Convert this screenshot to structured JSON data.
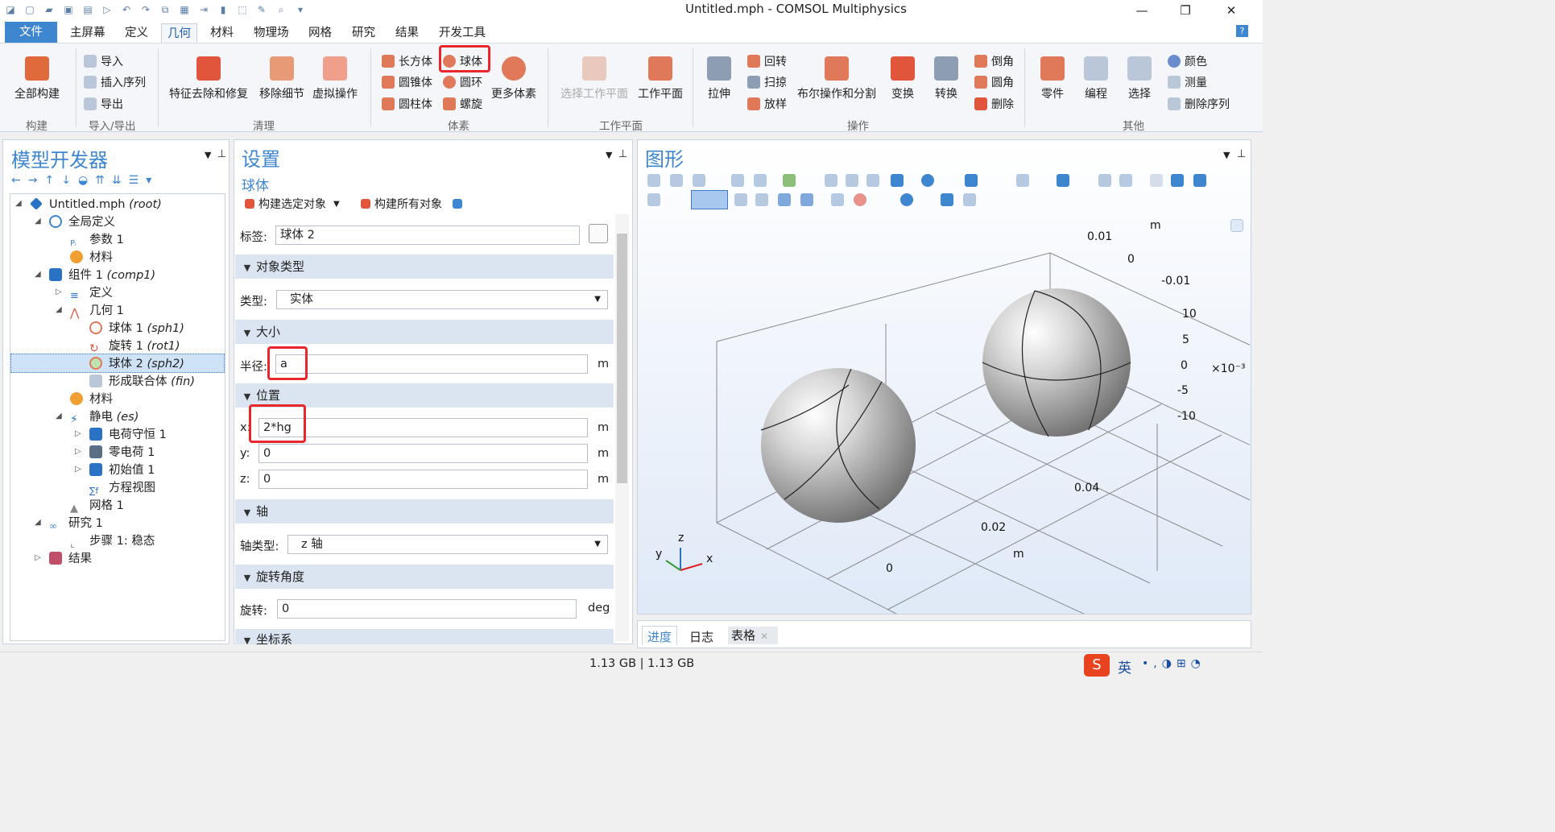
{
  "window": {
    "title": "Untitled.mph - COMSOL Multiphysics",
    "minimize": "—",
    "restore": "❐",
    "close": "✕"
  },
  "menu": {
    "file": "文件",
    "tabs": [
      "主屏幕",
      "定义",
      "几何",
      "材料",
      "物理场",
      "网格",
      "研究",
      "结果",
      "开发工具"
    ],
    "help": "?"
  },
  "ribbon": {
    "build_all": "全部构建",
    "import": "导入",
    "insert_sequence": "插入序列",
    "export": "导出",
    "feature_repair": "特征去除和修复",
    "remove_details": "移除细节",
    "virtual_ops": "虚拟操作",
    "block": "长方体",
    "cone": "圆锥体",
    "cylinder": "圆柱体",
    "sphere": "球体",
    "torus": "圆环",
    "helix": "螺旋",
    "more_primitives": "更多体素",
    "select_work_plane": "选择工作平面",
    "work_plane": "工作平面",
    "extrude": "拉伸",
    "revolve": "回转",
    "sweep": "扫掠",
    "loft": "放样",
    "booleans": "布尔操作和分割",
    "transforms": "变换",
    "conversions": "转换",
    "chamfer": "倒角",
    "fillet": "圆角",
    "delete": "删除",
    "parts": "零件",
    "programming": "编程",
    "selections": "选择",
    "colors": "颜色",
    "measure": "测量",
    "delete_sequence": "删除序列",
    "groups": {
      "build": "构建",
      "import_export": "导入/导出",
      "cleanup": "清理",
      "primitives": "体素",
      "work_planes": "工作平面",
      "operations": "操作",
      "other": "其他"
    }
  },
  "model_builder": {
    "title": "模型开发器",
    "items": [
      {
        "label": "Untitled.mph",
        "tag": "(root)"
      },
      {
        "label": "全局定义",
        "tag": ""
      },
      {
        "label": "参数 1",
        "tag": ""
      },
      {
        "label": "材料",
        "tag": ""
      },
      {
        "label": "组件 1",
        "tag": "(comp1)"
      },
      {
        "label": "定义",
        "tag": ""
      },
      {
        "label": "几何 1",
        "tag": ""
      },
      {
        "label": "球体 1",
        "tag": "(sph1)"
      },
      {
        "label": "旋转 1",
        "tag": "(rot1)"
      },
      {
        "label": "球体 2",
        "tag": "(sph2)"
      },
      {
        "label": "形成联合体",
        "tag": "(fin)"
      },
      {
        "label": "材料",
        "tag": ""
      },
      {
        "label": "静电",
        "tag": "(es)"
      },
      {
        "label": "电荷守恒 1",
        "tag": ""
      },
      {
        "label": "零电荷 1",
        "tag": ""
      },
      {
        "label": "初始值 1",
        "tag": ""
      },
      {
        "label": "方程视图",
        "tag": ""
      },
      {
        "label": "网格 1",
        "tag": ""
      },
      {
        "label": "研究 1",
        "tag": ""
      },
      {
        "label": "步骤 1: 稳态",
        "tag": ""
      },
      {
        "label": "结果",
        "tag": ""
      }
    ]
  },
  "settings": {
    "title": "设置",
    "subtitle": "球体",
    "build_selected": "构建选定对象",
    "build_all": "构建所有对象",
    "label_caption": "标签:",
    "label_value": "球体 2",
    "sec_object_type": "对象类型",
    "type_caption": "类型:",
    "type_value": "实体",
    "sec_size": "大小",
    "radius_caption": "半径:",
    "radius_value": "a",
    "sec_position": "位置",
    "x_caption": "x:",
    "x_value": "2*hg",
    "y_caption": "y:",
    "y_value": "0",
    "z_caption": "z:",
    "z_value": "0",
    "unit_m": "m",
    "sec_axis": "轴",
    "axis_type_caption": "轴类型:",
    "axis_type_value": "z 轴",
    "sec_rotation": "旋转角度",
    "rotation_caption": "旋转:",
    "rotation_value": "0",
    "unit_deg": "deg",
    "sec_coord": "坐标系"
  },
  "graphics": {
    "title": "图形",
    "axis_labels": {
      "m_top": "m",
      "y_001": "0.01",
      "y_0": "0",
      "y_m001": "-0.01",
      "z_10": "10",
      "z_5": "5",
      "z_0": "0",
      "z_m5": "-5",
      "z_m10": "-10",
      "z_scale": "×10⁻³",
      "x_004": "0.04",
      "x_002": "0.02",
      "x_m": "m",
      "x_0": "0"
    },
    "triad": {
      "x": "x",
      "y": "y",
      "z": "z"
    }
  },
  "bottom_tabs": [
    "进度",
    "日志",
    "表格"
  ],
  "status": {
    "memory": "1.13 GB | 1.13 GB"
  },
  "taskbar": {
    "ime": "英"
  },
  "colors": {
    "accent": "#3f86d0",
    "highlight": "#e8262b",
    "section_bg": "#dbe5f1"
  }
}
